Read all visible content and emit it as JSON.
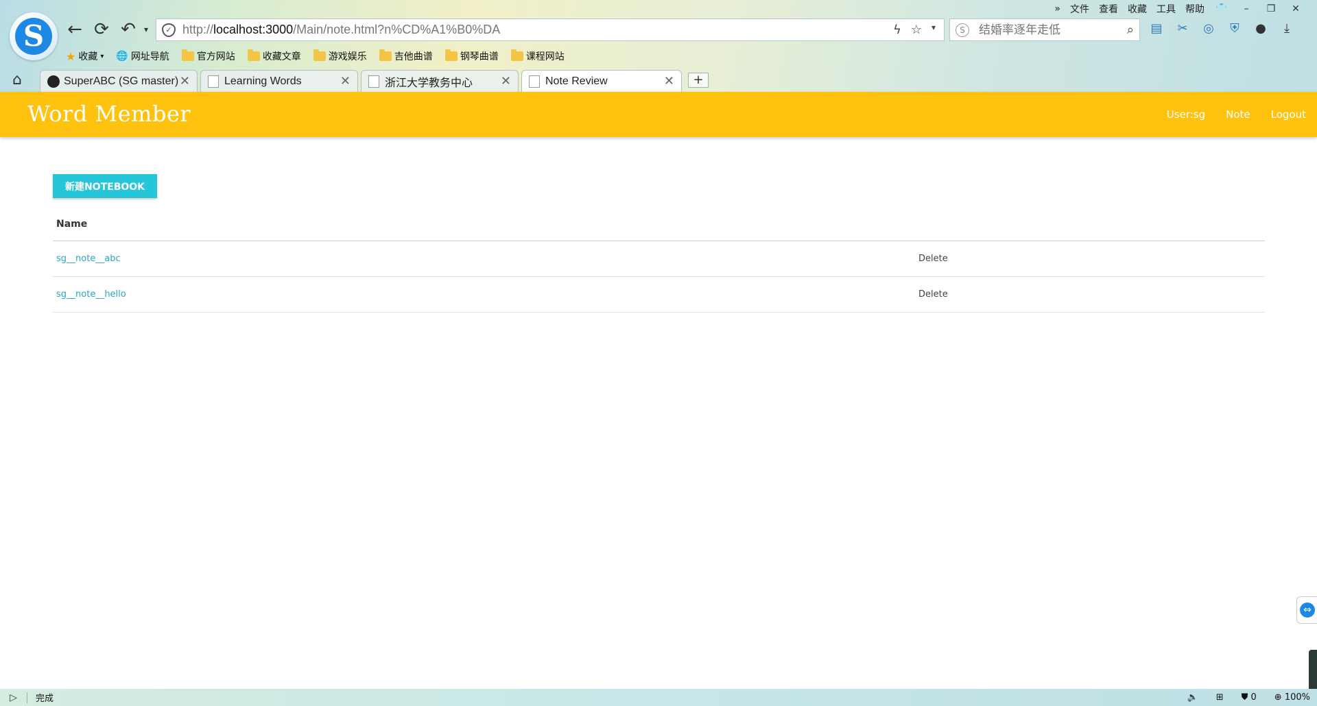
{
  "menubar": {
    "items": [
      "文件",
      "查看",
      "收藏",
      "工具",
      "帮助"
    ],
    "more": "»"
  },
  "address": {
    "url_prefix": "http://",
    "url_host": "localhost:3000",
    "url_path": "/Main/note.html?n%CD%A1%B0%DA"
  },
  "search": {
    "placeholder": "结婚率逐年走低"
  },
  "bookmarks": {
    "favorites": "收藏",
    "nav": "网址导航",
    "folders": [
      "官方网站",
      "收藏文章",
      "游戏娱乐",
      "吉他曲谱",
      "钢琴曲谱",
      "课程网站"
    ]
  },
  "tabs": [
    {
      "title": "SuperABC (SG master)"
    },
    {
      "title": "Learning Words"
    },
    {
      "title": "浙江大学教务中心"
    },
    {
      "title": "Note Review"
    }
  ],
  "header": {
    "brand": "Word Member",
    "nav": {
      "user": "User:sg",
      "note": "Note",
      "logout": "Logout"
    }
  },
  "main": {
    "new_button": "新建NOTEBOOK",
    "table_header": "Name",
    "notes": [
      {
        "name": "sg__note__abc",
        "action": "Delete"
      },
      {
        "name": "sg__note__hello",
        "action": "Delete"
      }
    ]
  },
  "statusbar": {
    "status": "完成",
    "counter": "0",
    "zoom": "100%"
  },
  "colors": {
    "header": "#fec20f",
    "button": "#26c6da",
    "link": "#26a6c9"
  }
}
